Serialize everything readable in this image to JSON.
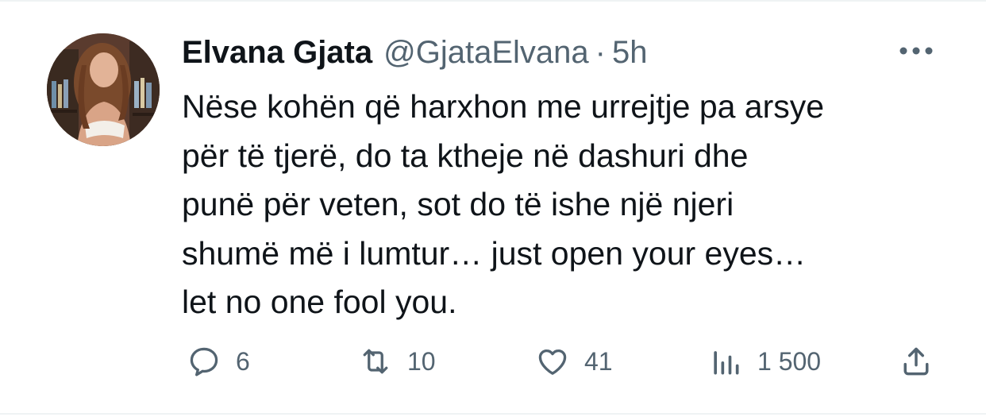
{
  "tweet": {
    "author": {
      "display_name": "Elvana Gjata",
      "handle": "@GjataElvana",
      "separator": "·",
      "time": "5h"
    },
    "text_lines": [
      "Nëse kohën që harxhon me urrejtje pa arsye",
      "për të tjerë, do ta ktheje në dashuri dhe",
      "punë për veten, sot do të ishe një njeri",
      "shumë më i lumtur… just open your eyes…",
      "let no one fool you."
    ],
    "metrics": {
      "replies": "6",
      "retweets": "10",
      "likes": "41",
      "views": "1 500"
    }
  },
  "icons": {
    "avatar": "profile-photo",
    "more": "more-horizontal-icon",
    "reply": "reply-icon",
    "retweet": "retweet-icon",
    "like": "heart-icon",
    "views": "views-chart-icon",
    "share": "share-icon"
  },
  "colors": {
    "text_primary": "#0f1419",
    "text_secondary": "#536471",
    "divider": "#eff3f4"
  }
}
